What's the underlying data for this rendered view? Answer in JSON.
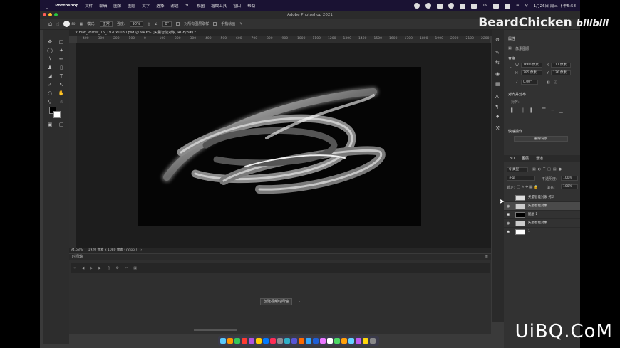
{
  "menubar": {
    "app": "Photoshop",
    "items": [
      "文件",
      "编辑",
      "图像",
      "图层",
      "文字",
      "选择",
      "滤镜",
      "3D",
      "视图",
      "增效工具",
      "窗口",
      "帮助"
    ],
    "battery": "19",
    "clock": "1月26日 周三 下午5:58"
  },
  "window": {
    "title": "Adobe Photoshop 2021"
  },
  "options": {
    "brush_size": "80",
    "mode_label": "模式:",
    "mode_value": "正常",
    "opacity_label": "强度:",
    "opacity_value": "90%",
    "angle_value": "0°",
    "sample_all": "对所有图层取样",
    "finger_paint": "手指绘画"
  },
  "document": {
    "tab": "Flat_Poster_16_1920x1080.psd @ 94.6% (矢量智能对象, RGB/8#) *",
    "zoom": "94.58%",
    "info": "1920 像素 x 1080 像素 (72 ppi)"
  },
  "ruler": [
    "400",
    "300",
    "200",
    "100",
    "0",
    "100",
    "200",
    "300",
    "400",
    "500",
    "600",
    "700",
    "800",
    "900",
    "1000",
    "1100",
    "1200",
    "1300",
    "1400",
    "1500",
    "1600",
    "1700",
    "1800",
    "1900",
    "2000",
    "2100",
    "2200"
  ],
  "timeline": {
    "title": "时间轴",
    "create_button": "创建视频时间轴"
  },
  "properties": {
    "title": "属性",
    "type_label": "像素图层",
    "transform_title": "变换",
    "w_label": "W",
    "w_value": "1660 像素",
    "x_label": "X",
    "x_value": "117 像素",
    "h_label": "H",
    "h_value": "795 像素",
    "y_label": "Y",
    "y_value": "136 像素",
    "rotation": "0.00°",
    "align_title": "对齐并分布",
    "align_sub": "对齐:",
    "quick_title": "快速操作",
    "remove_bg": "删除背景"
  },
  "layers": {
    "tabs": [
      "3D",
      "图层",
      "通道"
    ],
    "filter": "Q 类型",
    "blend_mode": "正常",
    "opacity_label": "不透明度:",
    "opacity_value": "100%",
    "lock_label": "锁定:",
    "fill_label": "填充:",
    "fill_value": "100%",
    "rows": [
      {
        "name": "矢量智能对象 拷贝"
      },
      {
        "name": "矢量智能对象"
      },
      {
        "name": "图层 1"
      },
      {
        "name": "矢量智能对象"
      },
      {
        "name": "1"
      }
    ]
  },
  "watermarks": {
    "top": "BeardChicken",
    "top_logo": "bilibili",
    "bottom": "UiBQ.CoM"
  },
  "colors": {
    "menubar": "#1a1233",
    "panel": "#323232",
    "canvas": "#1d1d1d",
    "artboard": "#050505"
  }
}
